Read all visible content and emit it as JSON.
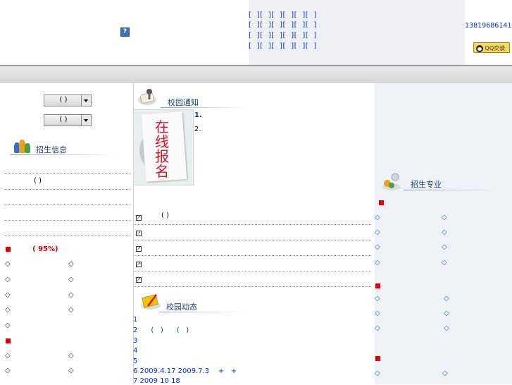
{
  "header": {
    "help_icon_glyph": "?",
    "nav_rows": [
      "[  ][  ][  ][  ][  ][  ]",
      "[  ][  ][  ][  ][  ][  ]",
      "[  ][  ][  ][  ][  ][  ]",
      "[  ][  ][  ][  ][  ][  ]"
    ],
    "phone": "13819686141",
    "qq_label": "QQ交谈"
  },
  "left": {
    "select1": "( )",
    "select2": "( )",
    "admission_info_title": "招生信息",
    "info_item_1": "( )",
    "red_heading": "(        95%)",
    "red_color": "#e00000",
    "diamond": "◇"
  },
  "middle": {
    "notice_title": "校园通知",
    "notice_items": [
      "1.",
      "2."
    ],
    "signup_image_words": [
      "在",
      "线",
      "报",
      "名"
    ],
    "arrow_glyph": "↗",
    "list_item_1": "( )",
    "news_title": "校园动态",
    "news_items": [
      "1",
      "2      (   )      (   )",
      "3",
      "4",
      "5",
      "6 2009.4.17 2009.7.3    +   +",
      "7 2009 10 18"
    ]
  },
  "right": {
    "majors_title": "招生专业",
    "diamond": "◇"
  }
}
